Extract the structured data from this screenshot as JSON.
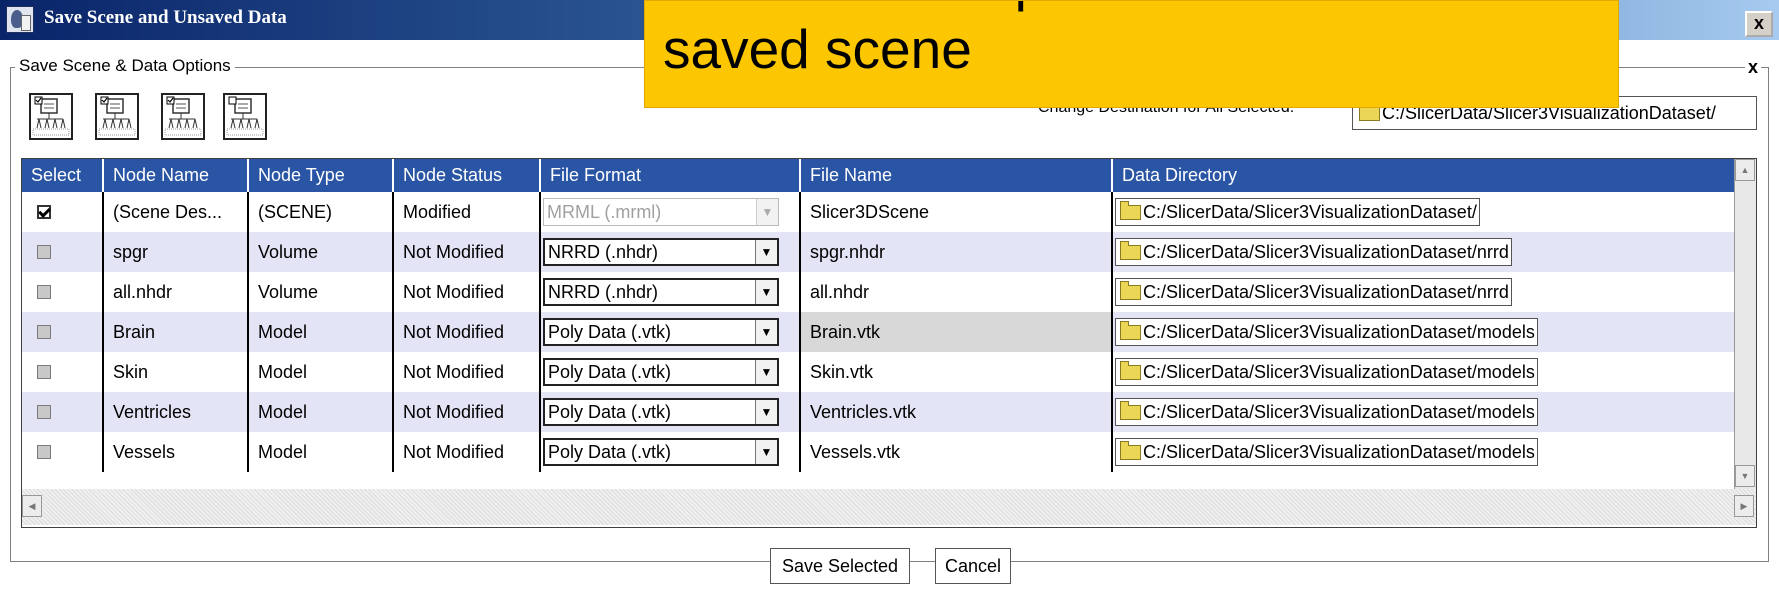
{
  "window": {
    "title": "Save Scene and Unsaved Data",
    "close_label": "x"
  },
  "group": {
    "legend": "Save Scene & Data Options",
    "close_label": "x"
  },
  "toolbar_icons": [
    "select-all-icon",
    "select-modified-icon",
    "select-scene-icon",
    "select-none-icon"
  ],
  "destination": {
    "label": "Change Destination for All Selected:",
    "value": "C:/SlicerData/Slicer3VisualizationDataset/"
  },
  "table": {
    "columns": [
      "Select",
      "Node Name",
      "Node Type",
      "Node Status",
      "File Format",
      "File Name",
      "Data Directory"
    ],
    "rows": [
      {
        "selected": true,
        "name": "(Scene Des...",
        "type": "(SCENE)",
        "status": "Modified",
        "format": "MRML (.mrml)",
        "format_enabled": false,
        "file": "Slicer3DScene",
        "dir": "C:/SlicerData/Slicer3VisualizationDataset/"
      },
      {
        "selected": false,
        "name": "spgr",
        "type": "Volume",
        "status": "Not Modified",
        "format": "NRRD (.nhdr)",
        "format_enabled": true,
        "file": "spgr.nhdr",
        "dir": "C:/SlicerData/Slicer3VisualizationDataset/nrrd"
      },
      {
        "selected": false,
        "name": "all.nhdr",
        "type": "Volume",
        "status": "Not Modified",
        "format": "NRRD (.nhdr)",
        "format_enabled": true,
        "file": "all.nhdr",
        "dir": "C:/SlicerData/Slicer3VisualizationDataset/nrrd"
      },
      {
        "selected": false,
        "name": "Brain",
        "type": "Model",
        "status": "Not Modified",
        "format": "Poly Data (.vtk)",
        "format_enabled": true,
        "file": "Brain.vtk",
        "dir": "C:/SlicerData/Slicer3VisualizationDataset/models"
      },
      {
        "selected": false,
        "name": "Skin",
        "type": "Model",
        "status": "Not Modified",
        "format": "Poly Data (.vtk)",
        "format_enabled": true,
        "file": "Skin.vtk",
        "dir": "C:/SlicerData/Slicer3VisualizationDataset/models"
      },
      {
        "selected": false,
        "name": "Ventricles",
        "type": "Model",
        "status": "Not Modified",
        "format": "Poly Data (.vtk)",
        "format_enabled": true,
        "file": "Ventricles.vtk",
        "dir": "C:/SlicerData/Slicer3VisualizationDataset/models"
      },
      {
        "selected": false,
        "name": "Vessels",
        "type": "Model",
        "status": "Not Modified",
        "format": "Poly Data (.vtk)",
        "format_enabled": true,
        "file": "Vessels.vtk",
        "dir": "C:/SlicerData/Slicer3VisualizationDataset/models"
      }
    ]
  },
  "buttons": {
    "save": "Save Selected",
    "cancel": "Cancel"
  },
  "overlay": {
    "text": "two scene snapshots in the\nsaved scene",
    "color": "#fcc700"
  },
  "colors": {
    "header_bg": "#2a55a4",
    "alt_row_bg": "#e4e4f7"
  }
}
